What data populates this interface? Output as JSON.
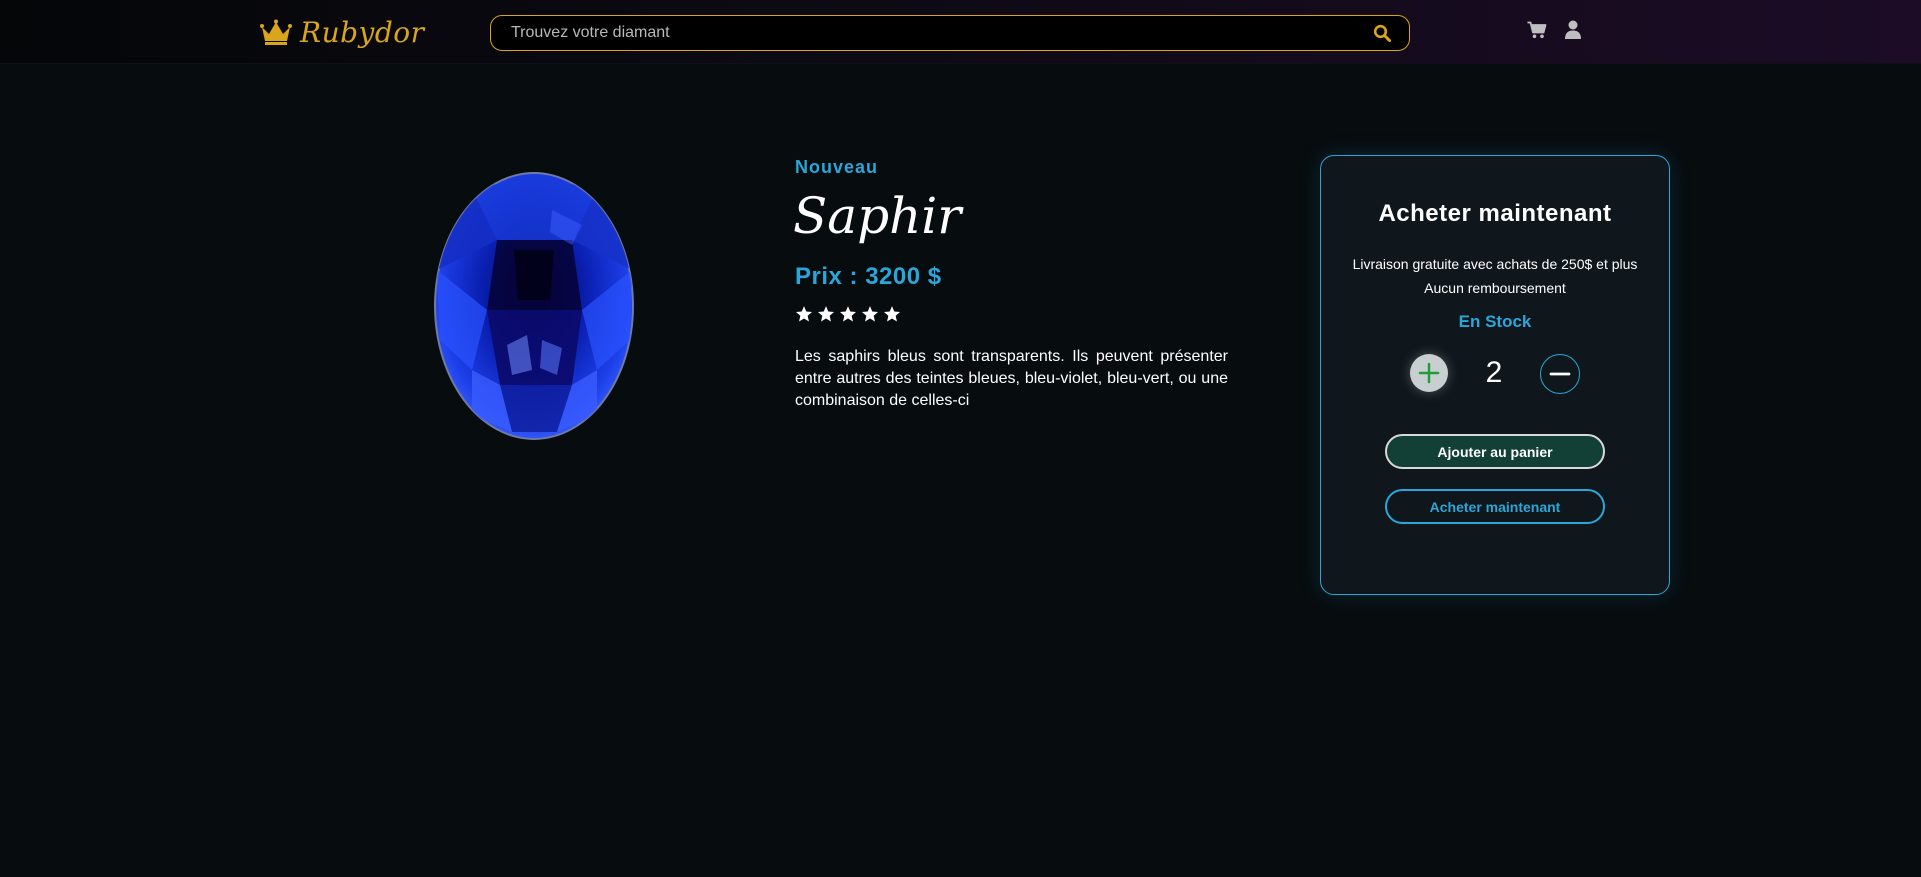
{
  "header": {
    "brand": "Rubydor",
    "search_placeholder": "Trouvez votre diamant",
    "icons": [
      "crown-icon",
      "search-icon",
      "cart-icon",
      "user-icon"
    ]
  },
  "product": {
    "badge": "Nouveau",
    "name": "Saphir",
    "price": "Prix : 3200 $",
    "rating": 5,
    "rating_max": 5,
    "description": "Les saphirs bleus sont transparents. Ils peuvent présenter entre autres des teintes bleues, bleu-violet, bleu-vert, ou une combinaison de celles-ci"
  },
  "buy_panel": {
    "title": "Acheter maintenant",
    "shipping": "Livraison gratuite avec achats de 250$ et plus",
    "refund": "Aucun remboursement",
    "stock": "En Stock",
    "quantity": "2",
    "add_to_cart": "Ajouter au panier",
    "buy_now": "Acheter maintenant"
  },
  "colors": {
    "accent": "#2aa6d8",
    "brand_gold": "#d8a51b",
    "background": "#070c0f",
    "cart_button": "#123f36",
    "plus_green": "#1e9e3a"
  }
}
